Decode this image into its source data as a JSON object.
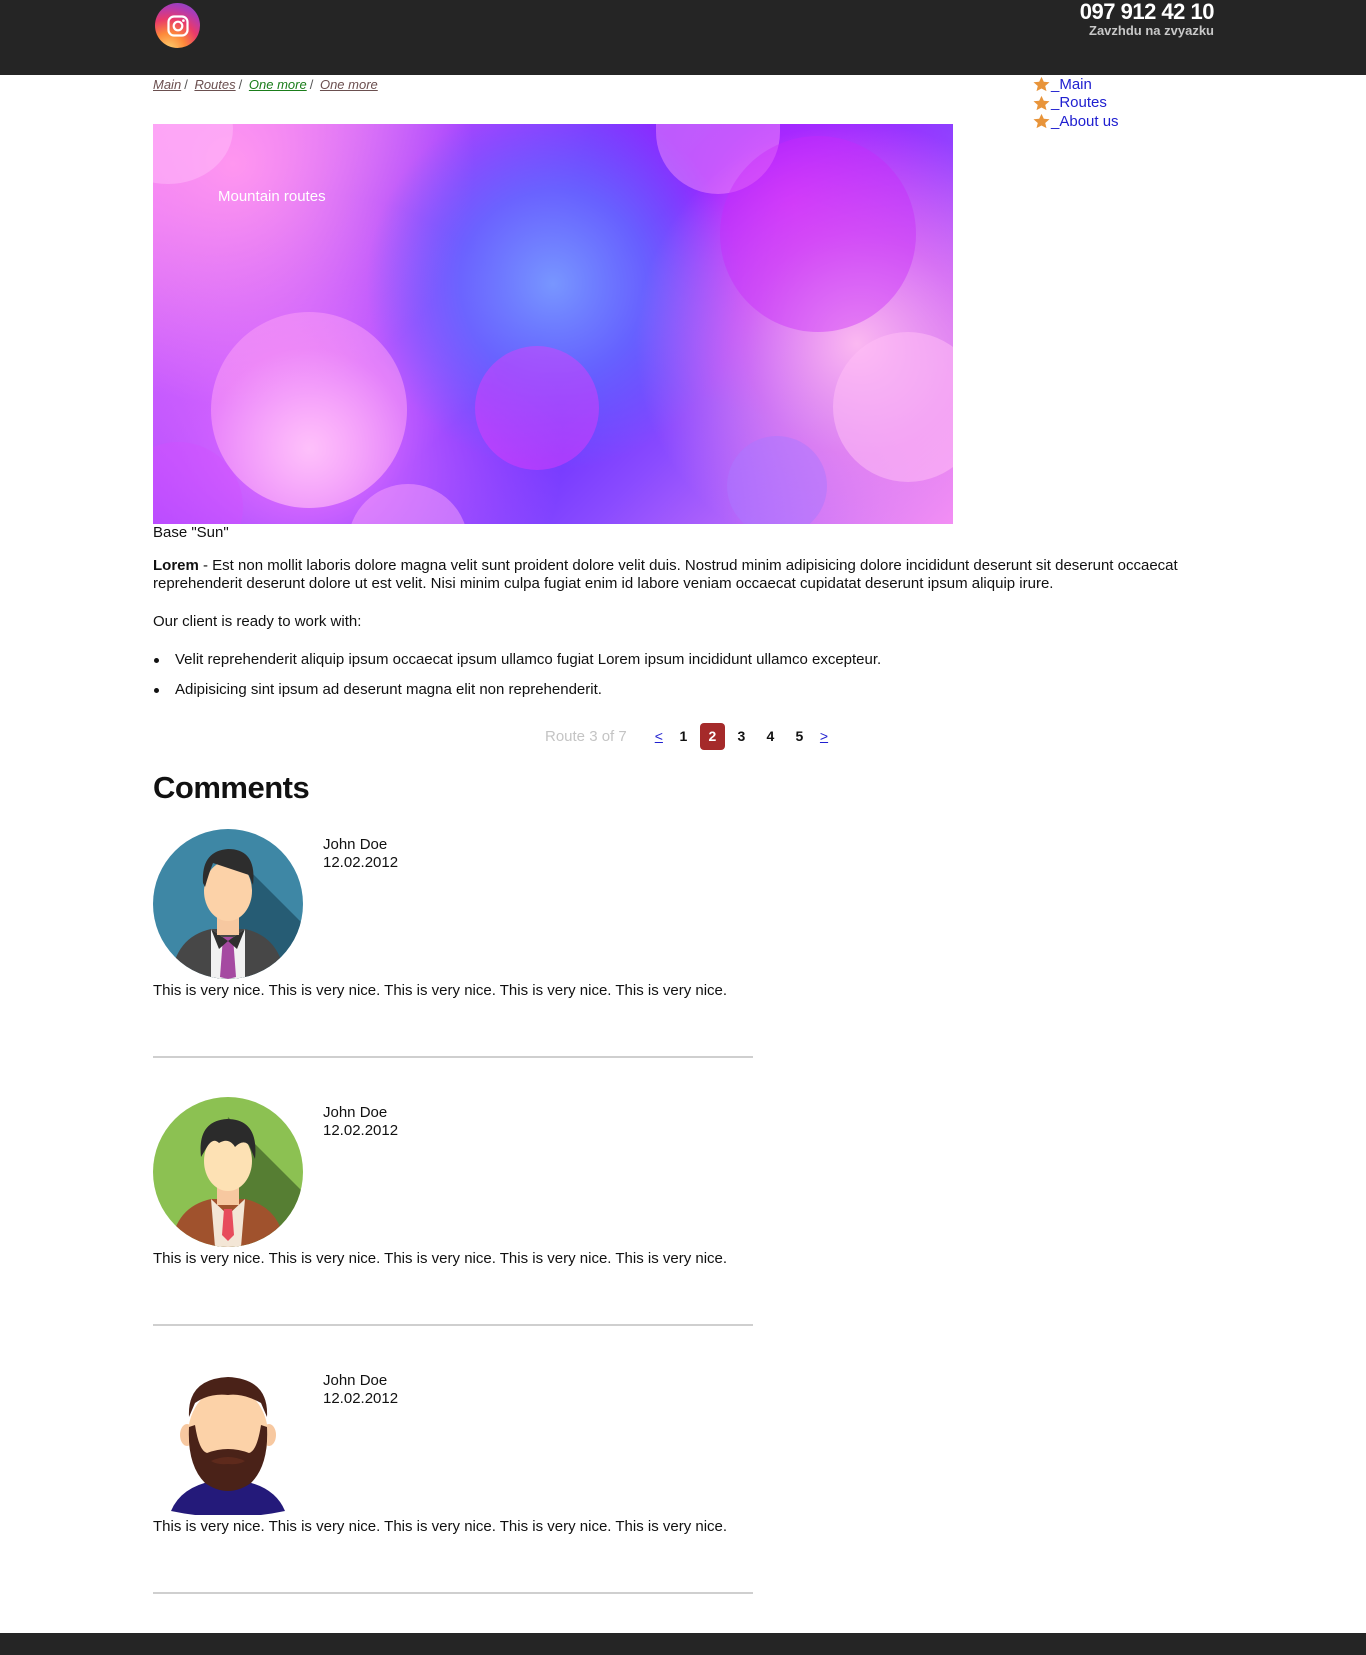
{
  "header": {
    "phone": "097 912 42 10",
    "tagline": "Zavzhdu na zvyazku",
    "social_icon": "instagram-icon"
  },
  "breadcrumb": [
    "Main",
    "Routes",
    "One more",
    "One more"
  ],
  "sidenav": {
    "items": [
      {
        "label": "Main",
        "icon": "star-icon"
      },
      {
        "label": "Routes",
        "icon": "star-icon"
      },
      {
        "label": "About us",
        "icon": "star-icon"
      }
    ],
    "icon_color": "#e8943a"
  },
  "hero": {
    "title": "Mountain routes",
    "caption": "Base \"Sun\""
  },
  "content": {
    "lead_bold": "Lorem",
    "lead_text": " - Est non mollit laboris dolore magna velit sunt proident dolore velit duis. Nostrud minim adipisicing dolore incididunt deserunt sit deserunt occaecat reprehenderit deserunt dolore ut est velit. Nisi minim culpa fugiat enim id labore veniam occaecat cupidatat deserunt ipsum aliquip irure.",
    "client_intro": "Our client is ready to work with:",
    "bullets": [
      "Velit reprehenderit aliquip ipsum occaecat ipsum ullamco fugiat Lorem ipsum incididunt ullamco excepteur.",
      "Adipisicing sint ipsum ad deserunt magna elit non reprehenderit."
    ]
  },
  "pagination": {
    "info": "Route 3 of 7",
    "prev": "<",
    "next": ">",
    "pages": [
      "1",
      "2",
      "3",
      "4",
      "5"
    ],
    "active_page": "2",
    "active_color": "#a52a2a"
  },
  "comments": {
    "title": "Comments",
    "items": [
      {
        "name": "John Doe",
        "date": "12.02.2012",
        "text": "This is very nice. This is very nice. This is very nice. This is very nice. This is very nice.",
        "avatar": "businessman-avatar-icon"
      },
      {
        "name": "John Doe",
        "date": "12.02.2012",
        "text": "This is very nice. This is very nice. This is very nice. This is very nice. This is very nice.",
        "avatar": "young-man-avatar-icon"
      },
      {
        "name": "John Doe",
        "date": "12.02.2012",
        "text": "This is very nice. This is very nice. This is very nice. This is very nice. This is very nice.",
        "avatar": "bearded-man-avatar-icon"
      }
    ]
  }
}
